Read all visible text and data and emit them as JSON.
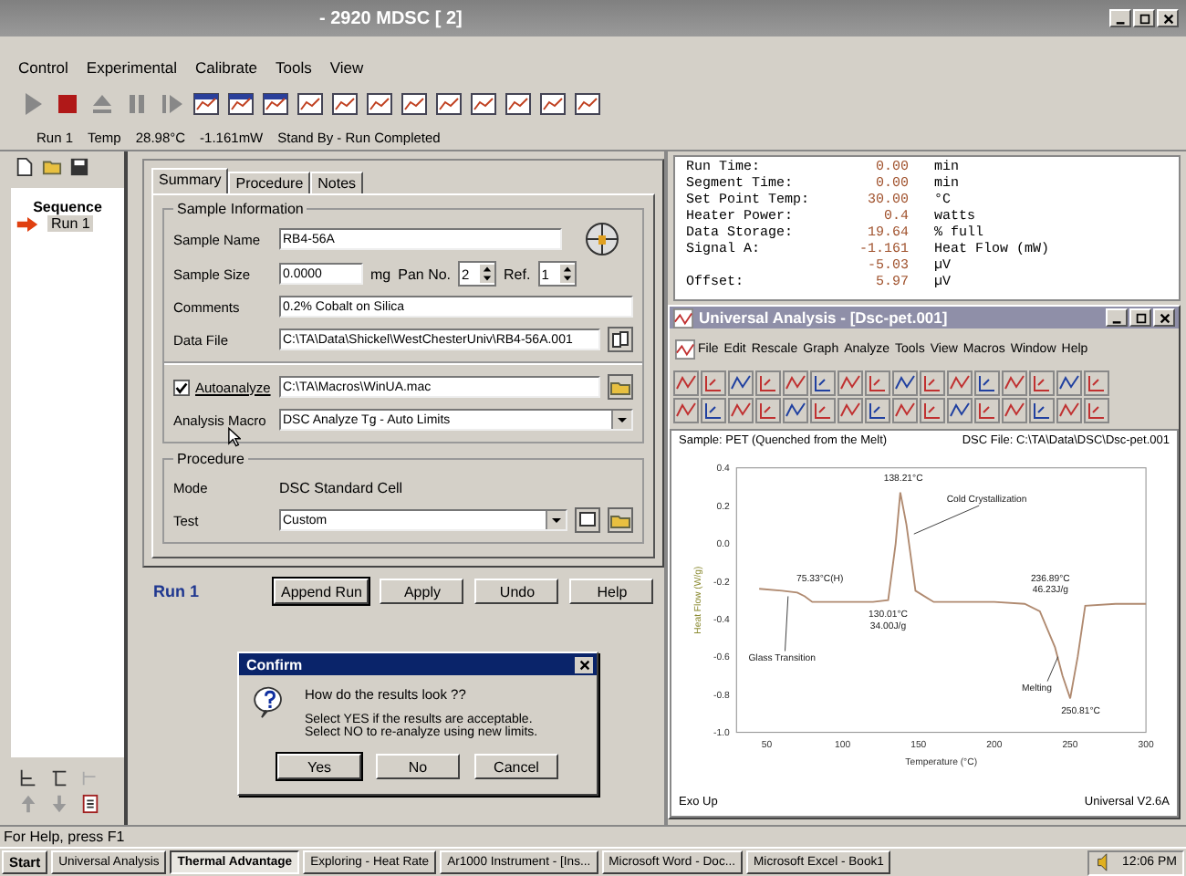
{
  "window": {
    "title": "- 2920 MDSC [ 2]"
  },
  "menu": [
    "Control",
    "Experimental",
    "Calibrate",
    "Tools",
    "View"
  ],
  "status_line": [
    "Run 1",
    "Temp",
    "28.98°C",
    "-1.161mW",
    "Stand By - Run Completed"
  ],
  "sequence": {
    "title": "Sequence",
    "items": [
      {
        "label": "Run 1",
        "selected": true
      }
    ]
  },
  "tabs": [
    {
      "label": "Summary",
      "selected": true
    },
    {
      "label": "Procedure",
      "selected": false
    },
    {
      "label": "Notes",
      "selected": false
    }
  ],
  "sample_information": {
    "title": "Sample Information",
    "sample_name": {
      "label": "Sample Name",
      "value": "RB4-56A"
    },
    "sample_size": {
      "label": "Sample Size",
      "value": "0.0000",
      "unit": "mg"
    },
    "pan_no": {
      "label": "Pan No.",
      "value": "2"
    },
    "ref": {
      "label": "Ref.",
      "value": "1"
    },
    "comments": {
      "label": "Comments",
      "value": "0.2% Cobalt on Silica"
    },
    "data_file": {
      "label": "Data File",
      "value": "C:\\TA\\Data\\Shickel\\WestChesterUniv\\RB4-56A.001"
    },
    "autoanalyze": {
      "label": "Autoanalyze",
      "checked": true,
      "value": "C:\\TA\\Macros\\WinUA.mac"
    },
    "analysis_macro": {
      "label": "Analysis Macro",
      "value": "DSC Analyze Tg - Auto Limits"
    }
  },
  "procedure": {
    "title": "Procedure",
    "mode_label": "Mode",
    "mode": "DSC Standard Cell",
    "test_label": "Test",
    "test": "Custom"
  },
  "run_label": "Run 1",
  "buttons": [
    "Append Run",
    "Apply",
    "Undo",
    "Help"
  ],
  "readings": [
    {
      "label": "Run Time:",
      "value": "0.00",
      "unit": "min"
    },
    {
      "label": "Segment Time:",
      "value": "0.00",
      "unit": "min"
    },
    {
      "label": "Set Point Temp:",
      "value": "30.00",
      "unit": "°C"
    },
    {
      "label": "Heater Power:",
      "value": "0.4",
      "unit": "watts"
    },
    {
      "label": "Data Storage:",
      "value": "19.64",
      "unit": "% full"
    },
    {
      "label": "Signal A:",
      "value": "-1.161",
      "unit": "Heat Flow (mW)"
    },
    {
      "value": "-5.03",
      "unit": "µV"
    },
    {
      "label": "Offset:",
      "value": "5.97",
      "unit": "µV"
    }
  ],
  "analysis_window": {
    "title": "Universal Analysis - [Dsc-pet.001]",
    "menu": [
      "File",
      "Edit",
      "Rescale",
      "Graph",
      "Analyze",
      "Tools",
      "View",
      "Macros",
      "Window",
      "Help"
    ],
    "sample": "Sample: PET (Quenched from the Melt)",
    "file": "DSC File: C:\\TA\\Data\\DSC\\Dsc-pet.001",
    "chart_data": {
      "type": "line",
      "xlabel": "Temperature (°C)",
      "ylabel": "Heat Flow (W/g)",
      "xlim": [
        30,
        300
      ],
      "ylim": [
        -1.0,
        0.4
      ],
      "xticks": [
        50,
        100,
        150,
        200,
        250,
        300
      ],
      "yticks": [
        {
          "value": -1,
          "label": "-1.0"
        },
        -0.8,
        -0.6,
        -0.4,
        -0.2,
        {
          "value": 0,
          "label": "0.0"
        },
        0.2,
        0.4
      ],
      "x": [
        45,
        60,
        70,
        75,
        80,
        90,
        100,
        120,
        130,
        135,
        138,
        142,
        148,
        160,
        200,
        220,
        230,
        240,
        245,
        250,
        255,
        260,
        280,
        300
      ],
      "series": [
        {
          "color": "#b08a70",
          "values": [
            -0.24,
            -0.25,
            -0.26,
            -0.28,
            -0.31,
            -0.31,
            -0.31,
            -0.31,
            -0.3,
            0.0,
            0.27,
            0.1,
            -0.25,
            -0.31,
            -0.31,
            -0.32,
            -0.36,
            -0.55,
            -0.7,
            -0.82,
            -0.6,
            -0.33,
            -0.32,
            -0.32
          ]
        }
      ],
      "annotations": [
        "138.21°C",
        "Cold Crystallization",
        "75.33°C(H)",
        "Glass Transition",
        "130.01°C",
        "34.00J/g",
        "236.89°C",
        "46.23J/g",
        "Melting",
        "250.81°C"
      ]
    },
    "footer_left": "Exo Up",
    "footer_right": "Universal V2.6A"
  },
  "dialog": {
    "title": "Confirm",
    "question": "How do the results look ??",
    "lines": [
      "Select YES if the results are acceptable.",
      "Select NO to re-analyze using new limits."
    ],
    "buttons": [
      "Yes",
      "No",
      "Cancel"
    ]
  },
  "status_bar": "For Help, press F1",
  "taskbar": {
    "start": "Start",
    "tasks": [
      {
        "label": "Universal Analysis",
        "selected": false
      },
      {
        "label": "Thermal Advantage",
        "selected": true
      },
      {
        "label": "Exploring - Heat Rate",
        "selected": false
      },
      {
        "label": "Ar1000 Instrument - [Ins...",
        "selected": false
      },
      {
        "label": "Microsoft Word - Doc...",
        "selected": false
      },
      {
        "label": "Microsoft Excel - Book1",
        "selected": false
      }
    ],
    "clock": "12:06 PM"
  }
}
